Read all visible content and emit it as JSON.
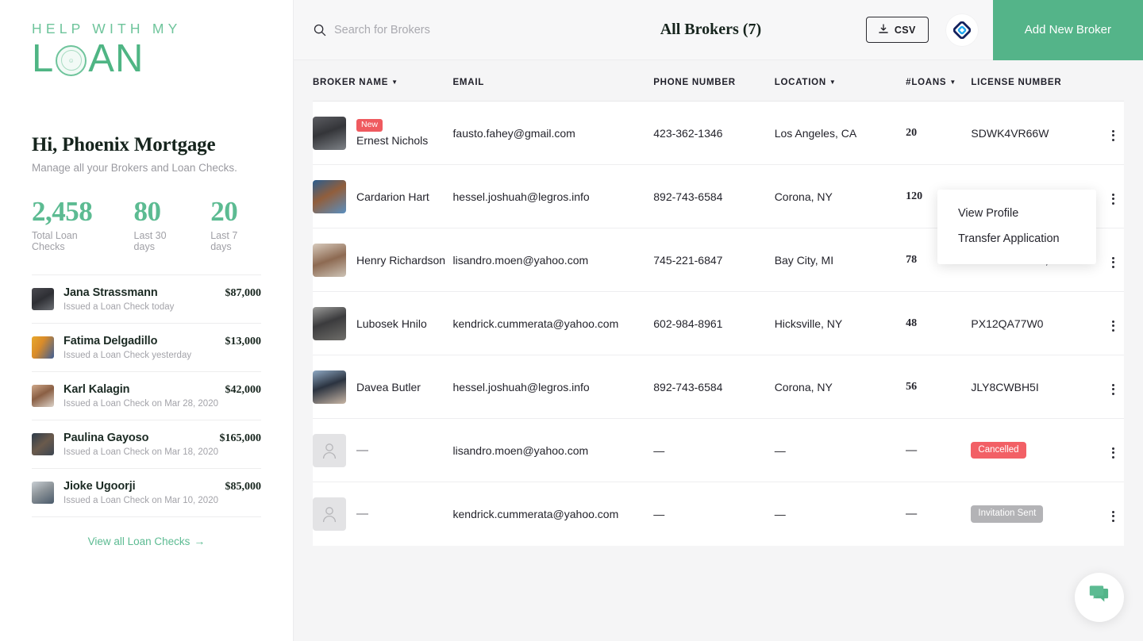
{
  "brand": {
    "logo_line1": "HELP WITH MY",
    "logo_line2_a": "L",
    "logo_line2_b": "AN",
    "accent_green": "#54b489",
    "badge_red": "#ef5a5f",
    "badge_gray": "#b3b3b6"
  },
  "sidebar": {
    "greeting": "Hi, Phoenix Mortgage",
    "subtitle": "Manage all your Brokers and Loan Checks.",
    "stats": [
      {
        "value": "2,458",
        "label": "Total Loan Checks"
      },
      {
        "value": "80",
        "label": "Last 30 days"
      },
      {
        "value": "20",
        "label": "Last 7 days"
      }
    ],
    "loan_checks": [
      {
        "name": "Jana Strassmann",
        "amount": "$87,000",
        "subtitle": "Issued a Loan Check today"
      },
      {
        "name": "Fatima Delgadillo",
        "amount": "$13,000",
        "subtitle": "Issued a Loan Check yesterday"
      },
      {
        "name": "Karl Kalagin",
        "amount": "$42,000",
        "subtitle": "Issued a Loan Check on Mar 28, 2020"
      },
      {
        "name": "Paulina Gayoso",
        "amount": "$165,000",
        "subtitle": "Issued a Loan Check on Mar 18, 2020"
      },
      {
        "name": "Jioke Ugoorji",
        "amount": "$85,000",
        "subtitle": "Issued a Loan Check on Mar 10, 2020"
      }
    ],
    "view_all_label": "View all Loan Checks",
    "view_all_arrow": "→"
  },
  "topbar": {
    "search_placeholder": "Search for Brokers",
    "search_value": "",
    "title": "All Brokers (7)",
    "csv_label": "CSV",
    "add_broker_label": "Add New Broker"
  },
  "table": {
    "columns": [
      {
        "label": "BROKER NAME",
        "sortable": true
      },
      {
        "label": "EMAIL",
        "sortable": false
      },
      {
        "label": "PHONE NUMBER",
        "sortable": false
      },
      {
        "label": "LOCATION",
        "sortable": true
      },
      {
        "label": "#LOANS",
        "sortable": true
      },
      {
        "label": "LICENSE NUMBER",
        "sortable": false
      }
    ],
    "rows": [
      {
        "badge": "New",
        "name": "Ernest Nichols",
        "email": "fausto.fahey@gmail.com",
        "phone": "423-362-1346",
        "location": "Los Angeles, CA",
        "loans": "20",
        "license": "SDWK4VR66W",
        "license_extra": "",
        "status": "",
        "has_avatar": true
      },
      {
        "badge": "",
        "name": "Cardarion Hart",
        "email": "hessel.joshuah@legros.info",
        "phone": "892-743-6584",
        "location": "Corona, NY",
        "loans": "120",
        "license": "",
        "license_extra": "",
        "status": "",
        "has_avatar": true
      },
      {
        "badge": "",
        "name": "Henry Richardson",
        "email": "lisandro.moen@yahoo.com",
        "phone": "745-221-6847",
        "location": "Bay City, MI",
        "loans": "78",
        "license": "TMO43USIOW,",
        "license_extra": "+2",
        "status": "",
        "has_avatar": true
      },
      {
        "badge": "",
        "name": "Lubosek Hnilo",
        "email": "kendrick.cummerata@yahoo.com",
        "phone": "602-984-8961",
        "location": "Hicksville, NY",
        "loans": "48",
        "license": "PX12QA77W0",
        "license_extra": "",
        "status": "",
        "has_avatar": true
      },
      {
        "badge": "",
        "name": "Davea Butler",
        "email": "hessel.joshuah@legros.info",
        "phone": "892-743-6584",
        "location": "Corona, NY",
        "loans": "56",
        "license": "JLY8CWBH5I",
        "license_extra": "",
        "status": "",
        "has_avatar": true
      },
      {
        "badge": "",
        "name": "—",
        "email": "lisandro.moen@yahoo.com",
        "phone": "—",
        "location": "—",
        "loans": "—",
        "license": "",
        "license_extra": "",
        "status": "Cancelled",
        "status_kind": "cancelled",
        "has_avatar": false
      },
      {
        "badge": "",
        "name": "—",
        "email": "kendrick.cummerata@yahoo.com",
        "phone": "—",
        "location": "—",
        "loans": "—",
        "license": "",
        "license_extra": "",
        "status": "Invitation Sent",
        "status_kind": "invitation",
        "has_avatar": false
      }
    ]
  },
  "row_menu": {
    "items": [
      {
        "label": "View Profile"
      },
      {
        "label": "Transfer Application"
      }
    ]
  }
}
